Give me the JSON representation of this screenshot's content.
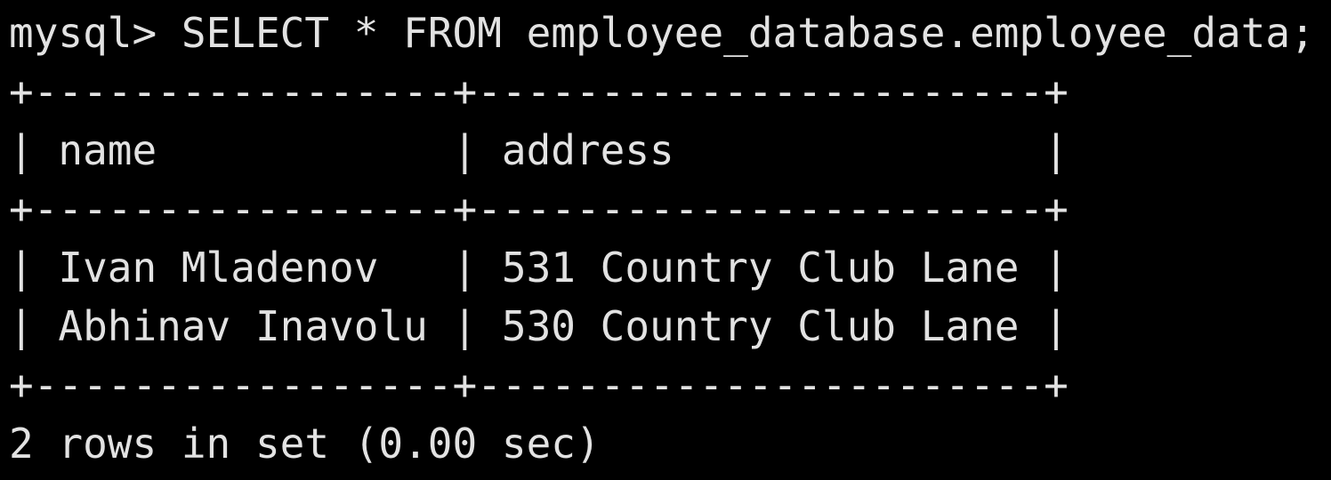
{
  "theme": {
    "background": "#000000",
    "foreground": "#e2e2e2"
  },
  "terminal": {
    "prompt": "mysql> ",
    "command": "SELECT * FROM employee_database.employee_data;",
    "table": {
      "border_line": "+-----------------+-----------------------+",
      "header_line": "| name            | address               |",
      "columns": [
        "name",
        "address"
      ],
      "rows": [
        {
          "line": "| Ivan Mladenov   | 531 Country Club Lane |",
          "cells": [
            "Ivan Mladenov",
            "531 Country Club Lane"
          ]
        },
        {
          "line": "| Abhinav Inavolu | 530 Country Club Lane |",
          "cells": [
            "Abhinav Inavolu",
            "530 Country Club Lane"
          ]
        }
      ]
    },
    "result_summary": "2 rows in set (0.00 sec)"
  }
}
